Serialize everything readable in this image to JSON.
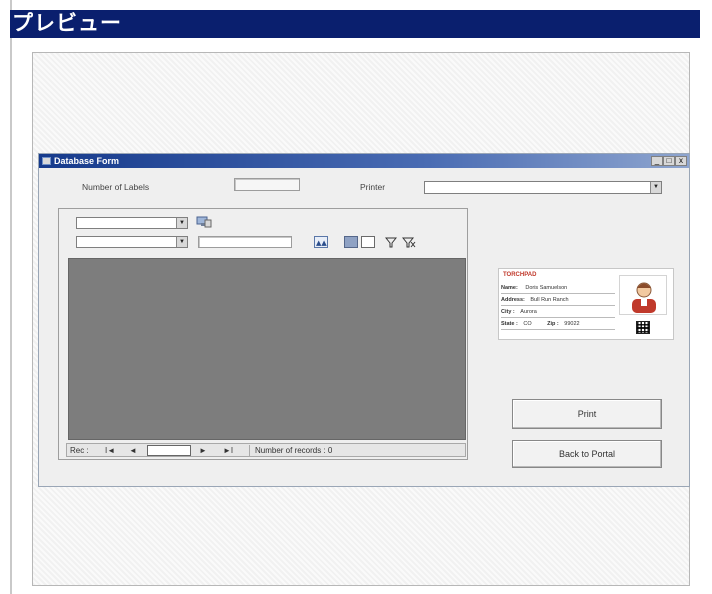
{
  "preview": {
    "title": "プレビュー"
  },
  "database_form": {
    "title": "Database Form",
    "window_buttons": {
      "minimize": "_",
      "maximize": "□",
      "close": "x"
    },
    "number_of_labels_label": "Number of Labels",
    "number_of_labels_value": "",
    "printer_label": "Printer",
    "printer_value": "",
    "filter_field_1": "",
    "filter_field_2": "",
    "filter_text": "",
    "navigator": {
      "rec_label": "Rec :",
      "first": "I◄",
      "prev": "◄",
      "next": "►",
      "last": "►I",
      "current_record": "",
      "records_label": "Number of records : 0"
    },
    "card_preview": {
      "logo": "TORCHPAD",
      "name_label": "Name:",
      "name_value": "Doris Samuelson",
      "address_label": "Address:",
      "address_value": "Bull Run Ranch",
      "city_label": "City :",
      "city_value": "Aurora",
      "state_label": "State :",
      "state_value": "CO",
      "zip_label": "Zip :",
      "zip_value": "99022"
    },
    "print_button": "Print",
    "back_button": "Back to Portal"
  }
}
